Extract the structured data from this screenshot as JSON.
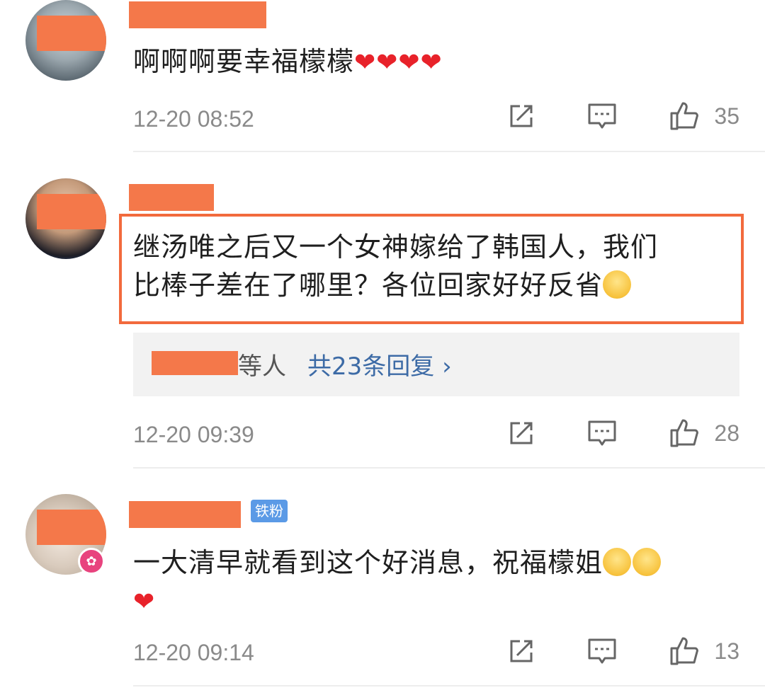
{
  "comments": [
    {
      "text": "啊啊啊要幸福檬檬",
      "hearts": "❤❤❤❤",
      "time": "12-20 08:52",
      "likes": "35"
    },
    {
      "text_line1": "继汤唯之后又一个女神嫁给了韩国人，我们",
      "text_line2": "比棒子差在了哪里？各位回家好好反省",
      "reply_who": "等人",
      "reply_count": "共23条回复 ›",
      "time": "12-20 09:39",
      "likes": "28"
    },
    {
      "badge": "铁粉",
      "text": "一大清早就看到这个好消息，祝福檬姐",
      "heart": "❤",
      "time": "12-20 09:14",
      "likes": "13"
    }
  ],
  "icons": {
    "share": "share-icon",
    "reply": "comment-icon",
    "like": "thumbs-up-icon"
  },
  "colors": {
    "highlight": "#f26a3d",
    "reply_link": "#3d6ba6",
    "badge": "#5b9ae6"
  }
}
